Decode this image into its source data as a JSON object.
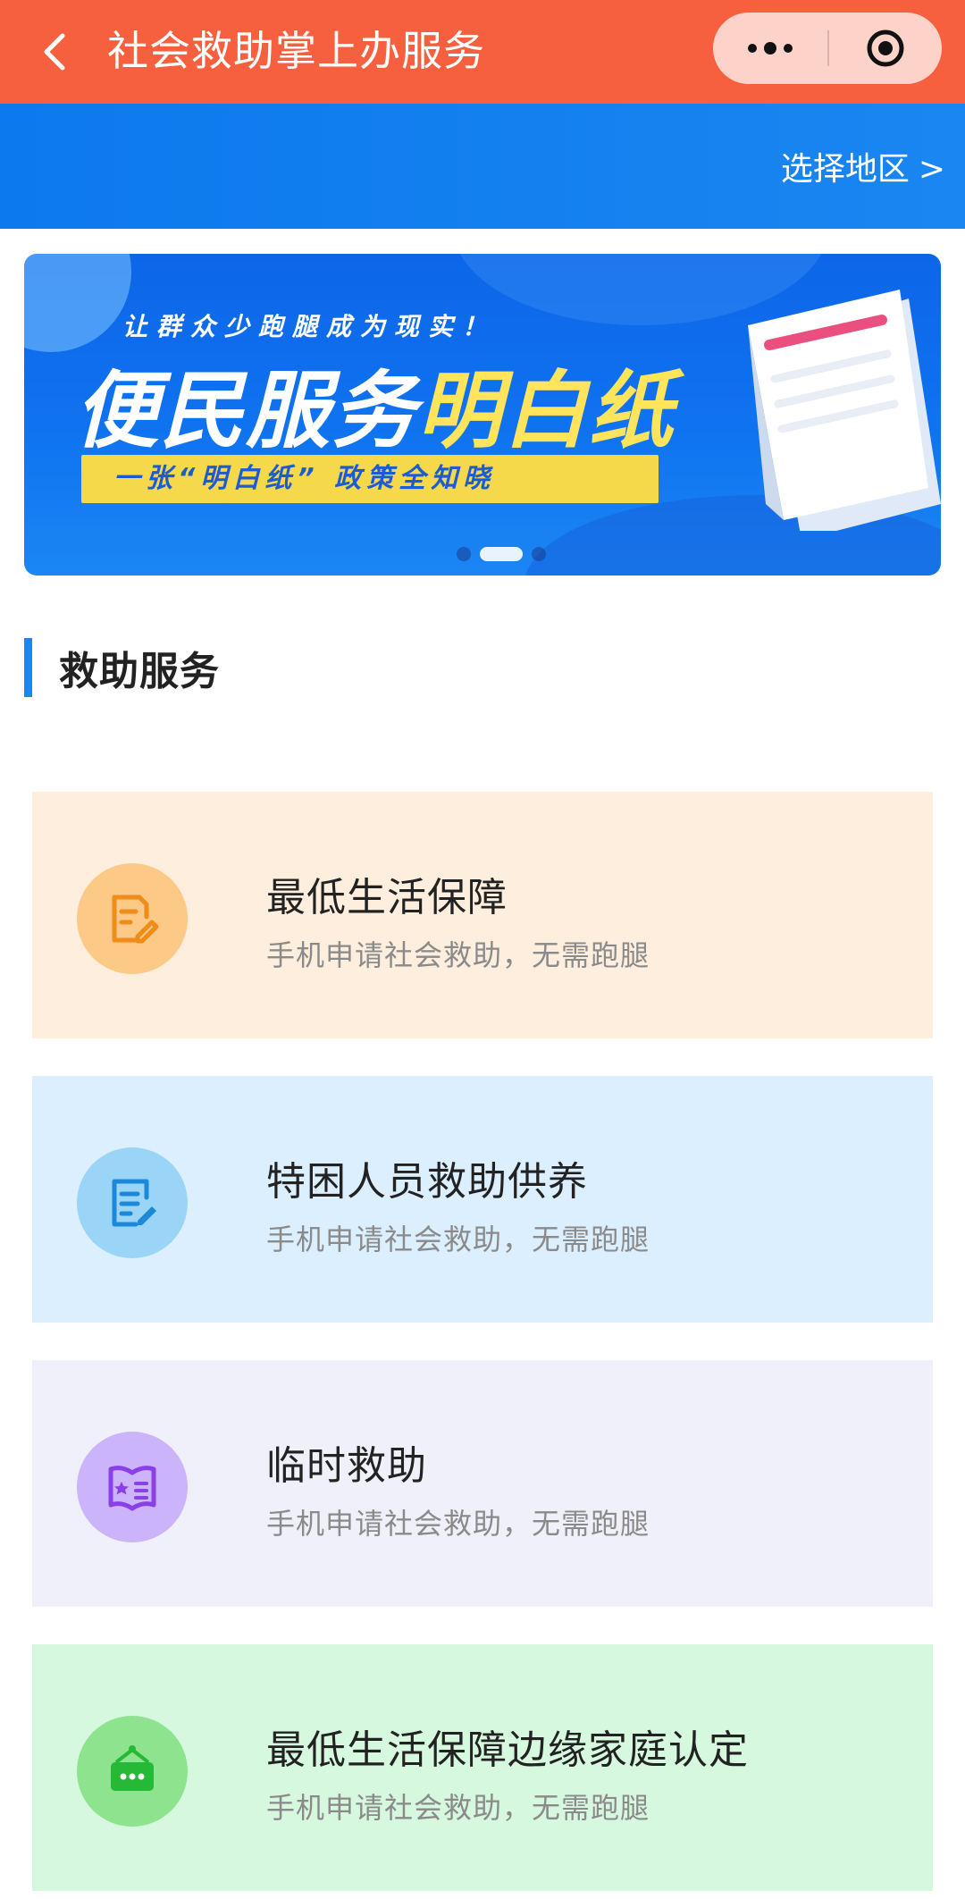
{
  "nav": {
    "title": "社会救助掌上办服务",
    "back_icon": "chevron-left-icon",
    "more_icon": "more-dots-icon",
    "target_icon": "target-icon"
  },
  "region": {
    "label": "选择地区",
    "arrow": ">"
  },
  "banner": {
    "subtitle": "让群众少跑腿成为现实！",
    "title_white": "便民服务",
    "title_yellow": "明白纸",
    "strip_text": "一张“明白纸” 政策全知晓",
    "pages": 3,
    "active_page": 2
  },
  "section": {
    "title": "救助服务"
  },
  "cards": [
    {
      "title": "最低生活保障",
      "desc": "手机申请社会救助，无需跑腿",
      "icon": "edit-document-icon",
      "bg": "#fdeedd",
      "icon_bg": "#fcc987",
      "icon_color": "#f08c1a"
    },
    {
      "title": "特困人员救助供养",
      "desc": "手机申请社会救助，无需跑腿",
      "icon": "edit-list-icon",
      "bg": "#dcefff",
      "icon_bg": "#9ad4f7",
      "icon_color": "#1e88d8"
    },
    {
      "title": "临时救助",
      "desc": "手机申请社会救助，无需跑腿",
      "icon": "star-book-icon",
      "bg": "#f0f0fb",
      "icon_bg": "#cbb4fa",
      "icon_color": "#8b3fe6"
    },
    {
      "title": "最低生活保障边缘家庭认定",
      "desc": "手机申请社会救助，无需跑腿",
      "icon": "hanging-sign-icon",
      "bg": "#d6f8df",
      "icon_bg": "#8ee38f",
      "icon_color": "#25b936"
    }
  ]
}
